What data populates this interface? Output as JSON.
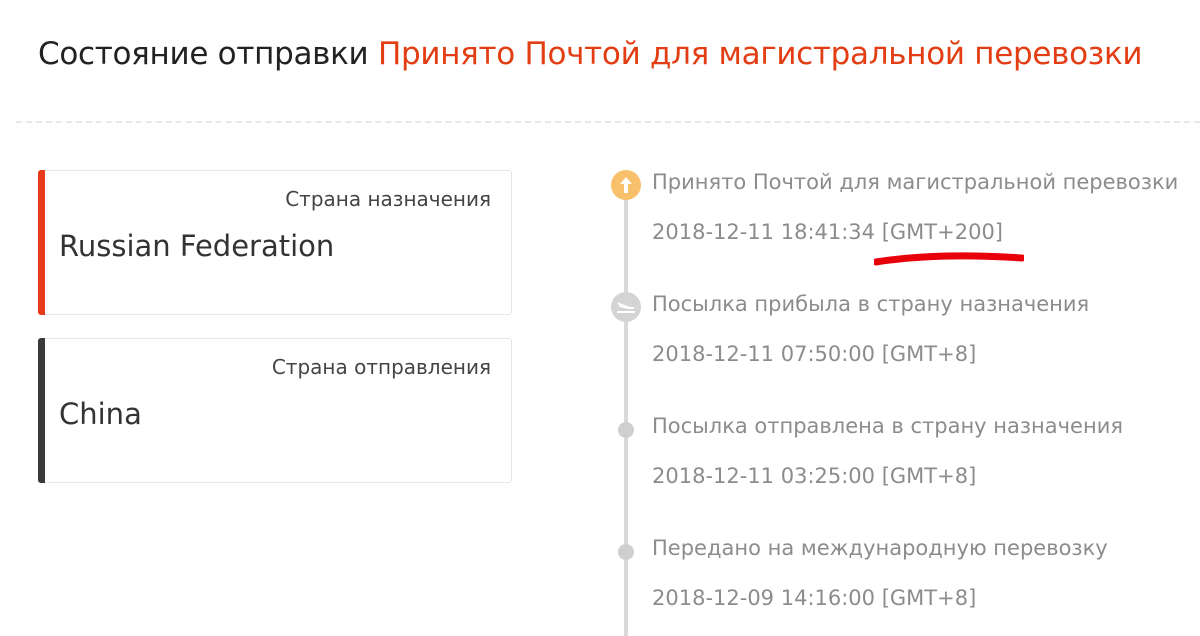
{
  "header": {
    "label": "Состояние отправки",
    "status": "Принято Почтой для магистральной перевозки"
  },
  "destination": {
    "label": "Страна назначения",
    "value": "Russian Federation",
    "accent_color": "#e8391c"
  },
  "origin": {
    "label": "Страна отправления",
    "value": "China",
    "accent_color": "#3a3a3a"
  },
  "timeline": [
    {
      "text": "Принято Почтой для магистральной перевозки",
      "time": "2018-12-11 18:41:34 [GMT+200]",
      "icon": "upload-arrow-icon",
      "color": "#f8c06a"
    },
    {
      "text": "Посылка прибыла в страну назначения",
      "time": "2018-12-11 07:50:00 [GMT+8]",
      "icon": "plane-landing-icon",
      "color": "#d4d4d4"
    },
    {
      "text": "Посылка отправлена в страну назначения",
      "time": "2018-12-11 03:25:00 [GMT+8]",
      "icon": "timeline-dot-icon",
      "color": "#cfcfcf"
    },
    {
      "text": "Передано на международную перевозку",
      "time": "2018-12-09 14:16:00 [GMT+8]",
      "icon": "timeline-dot-icon",
      "color": "#cfcfcf"
    }
  ],
  "annotation": {
    "icon": "red-underline-mark",
    "color": "#e8000b"
  }
}
